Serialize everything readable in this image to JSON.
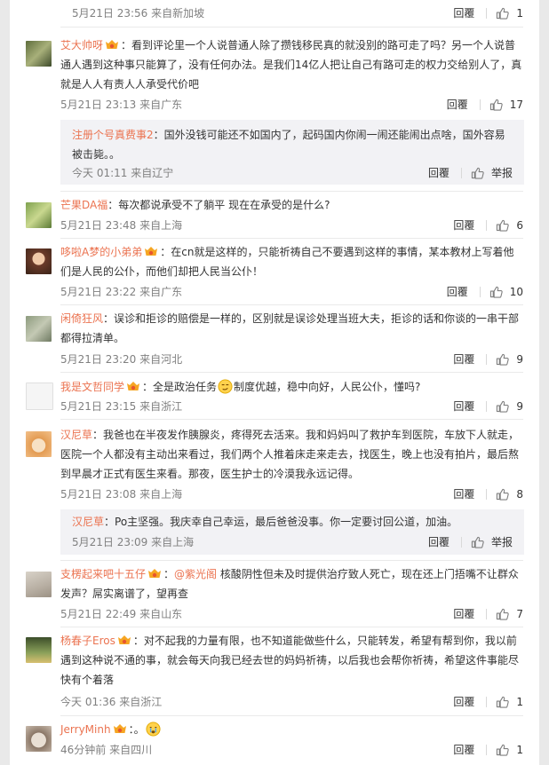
{
  "ui": {
    "reply_label": "回覆",
    "report_label": "举报",
    "colon": "：",
    "reply_prefix": "回复"
  },
  "comments": [
    {
      "time": "5月21日 23:56 来自新加坡",
      "likes": "1"
    },
    {
      "user": "艾大帅呀",
      "text": "看到评论里一个人说普通人除了攒钱移民真的就没别的路可走了吗？另一个人说普通人遇到这种事只能算了，没有任何办法。是我们14亿人把让自己有路可走的权力交给别人了，真就是人人有责人人承受代价吧",
      "time": "5月21日 23:13 来自广东",
      "likes": "17",
      "sub": {
        "user": "注册个号真费事2",
        "text": "国外没钱可能还不如国内了，起码国内你闹一闹还能闹出点啥，国外容易被击毙。。",
        "time": "今天 01:11 来自辽宁"
      }
    },
    {
      "user": "芒果DA福",
      "text": "每次都说承受不了躺平 现在在承受的是什么?",
      "time": "5月21日 23:48 来自上海",
      "likes": "6"
    },
    {
      "user": "哆啦A梦的小弟弟",
      "text": "在cn就是这样的，只能祈祷自己不要遇到这样的事情，某本教材上写着他们是人民的公仆，而他们却把人民当公仆！",
      "time": "5月21日 23:22 来自广东",
      "likes": "10"
    },
    {
      "user": "闲倚狂风",
      "text": "误诊和拒诊的赔偿是一样的，区别就是误诊处理当班大夫，拒诊的话和你谈的一串干部都得拉清单。",
      "time": "5月21日 23:20 来自河北",
      "likes": "9"
    },
    {
      "user": "我是文哲同学",
      "text_a": "全是政治任务",
      "text_b": "制度优越，稳中向好，人民公仆，懂吗?",
      "time": "5月21日 23:15 来自浙江",
      "likes": "9"
    },
    {
      "user": "汉尼草",
      "text": "我爸也在半夜发作胰腺炎，疼得死去活来。我和妈妈叫了救护车到医院，车放下人就走，医院一个人都没有主动出来看过，我们两个人推着床走来走去，找医生，晚上也没有拍片，最后熬到早晨才正式有医生来看。那夜，医生护士的冷漠我永远记得。",
      "time": "5月21日 23:08 来自上海",
      "likes": "8",
      "sub": {
        "user": "汉尼草",
        "text": "Po主坚强。我庆幸自己幸运，最后爸爸没事。你一定要讨回公道，加油。",
        "time": "5月21日 23:09 来自上海"
      }
    },
    {
      "user": "支楞起来吧十五仔",
      "mention": "@紫光阁",
      "text": " 核酸阴性但未及时提供治疗致人死亡，现在还上门捂嘴不让群众发声？屌实离谱了，望再查",
      "time": "5月21日 22:49 来自山东",
      "likes": "7"
    },
    {
      "user": "杨春子Eros",
      "text": "对不起我的力量有限，也不知道能做些什么，只能转发，希望有帮到你，我以前遇到这种说不通的事，就会每天向我已经去世的妈妈祈祷，以后我也会帮你祈祷，希望这件事能尽快有个着落",
      "time": "今天 01:36 来自浙江",
      "likes": "1"
    },
    {
      "user": "JerryMinh",
      "text": "。",
      "time": "46分钟前 来自四川",
      "likes": "1"
    }
  ],
  "colors": {
    "username": "#eb7350",
    "meta": "#808080",
    "text": "#333333",
    "subbox": "#f2f2f5",
    "background": "#e9e9e9"
  }
}
